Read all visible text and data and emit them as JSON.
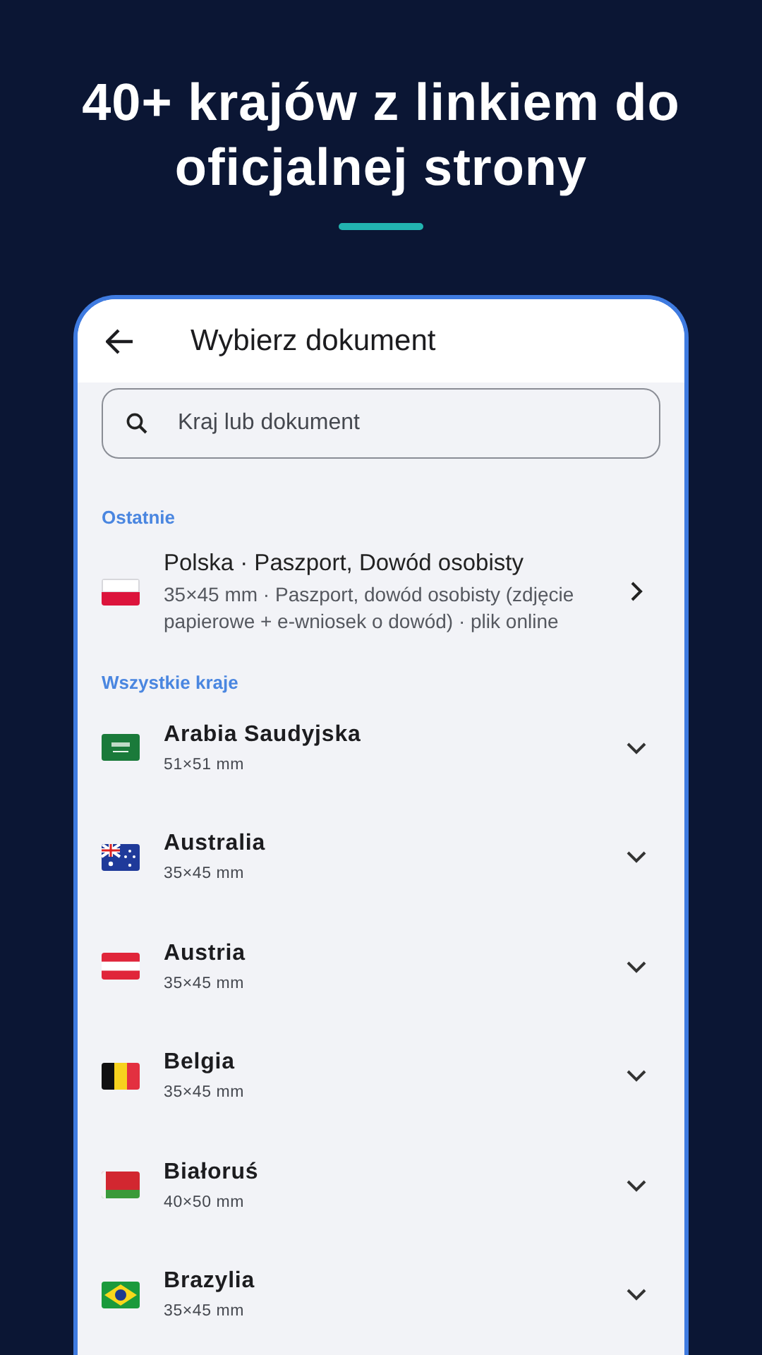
{
  "headline": "40+ krajów z linkiem do oficjalnej strony",
  "app_bar": {
    "title": "Wybierz dokument"
  },
  "search": {
    "placeholder": "Kraj lub dokument"
  },
  "recent": {
    "label": "Ostatnie",
    "items": [
      {
        "kind": "pl",
        "title": "Polska · Paszport, Dowód osobisty",
        "description": "35×45 mm · Paszport, dowód osobisty (zdjęcie papierowe + e-wniosek o dowód) · plik online"
      }
    ]
  },
  "all_countries": {
    "label": "Wszystkie kraje",
    "items": [
      {
        "kind": "sa",
        "name": "Arabia Saudyjska",
        "size": "51×51 mm",
        "expanded": false
      },
      {
        "kind": "au",
        "name": "Australia",
        "size": "35×45 mm",
        "expanded": false
      },
      {
        "kind": "at",
        "name": "Austria",
        "size": "35×45 mm",
        "expanded": false
      },
      {
        "kind": "be",
        "name": "Belgia",
        "size": "35×45 mm",
        "expanded": false
      },
      {
        "kind": "by",
        "name": "Białoruś",
        "size": "40×50 mm",
        "expanded": false
      },
      {
        "kind": "br",
        "name": "Brazylia",
        "size": "35×45 mm",
        "expanded": false
      }
    ]
  }
}
